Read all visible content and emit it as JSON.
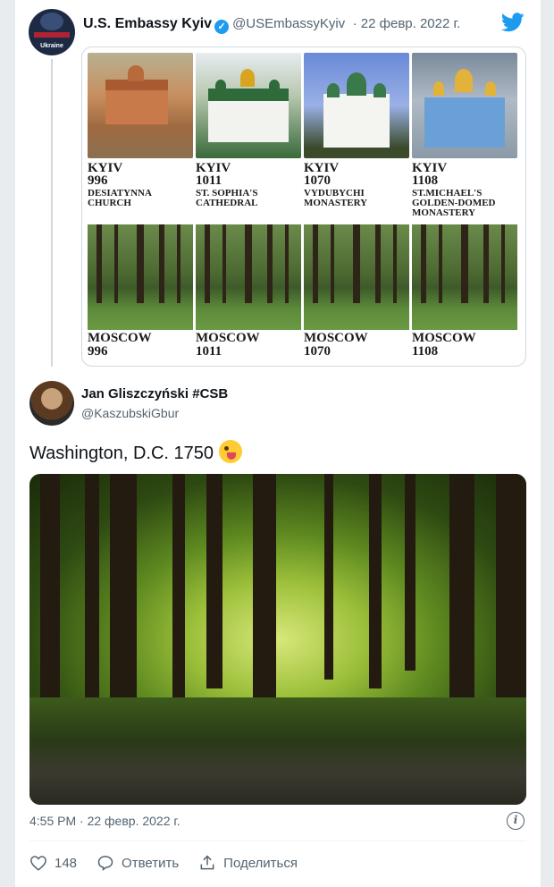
{
  "original_tweet": {
    "avatar_label": "Ukraine",
    "avatar_top_label": "U.S. EMBASSY",
    "author_name": "U.S. Embassy Kyiv",
    "handle": "@USEmbassyKyiv",
    "date": "· 22 февр. 2022 г.",
    "kyiv_items": [
      {
        "city": "KYIV",
        "year": "996",
        "desc": "DESIATYNNA CHURCH"
      },
      {
        "city": "KYIV",
        "year": "1011",
        "desc": "ST. SOPHIA'S CATHEDRAL"
      },
      {
        "city": "KYIV",
        "year": "1070",
        "desc": "VYDUBYCHI MONASTERY"
      },
      {
        "city": "KYIV",
        "year": "1108",
        "desc": "ST.MICHAEL'S GOLDEN-DOMED MONASTERY"
      }
    ],
    "moscow_items": [
      {
        "city": "MOSCOW",
        "year": "996"
      },
      {
        "city": "MOSCOW",
        "year": "1011"
      },
      {
        "city": "MOSCOW",
        "year": "1070"
      },
      {
        "city": "MOSCOW",
        "year": "1108"
      }
    ]
  },
  "reply": {
    "author_name": "Jan Gliszczyński #CSB",
    "handle": "@KaszubskiGbur",
    "text": "Washington, D.C.  1750",
    "timestamp": "4:55 PM · 22 февр. 2022 г.",
    "likes": "148",
    "reply_label": "Ответить",
    "share_label": "Поделиться",
    "info_label": "i"
  },
  "colors": {
    "accent": "#1d9bf0",
    "muted": "#536471"
  }
}
